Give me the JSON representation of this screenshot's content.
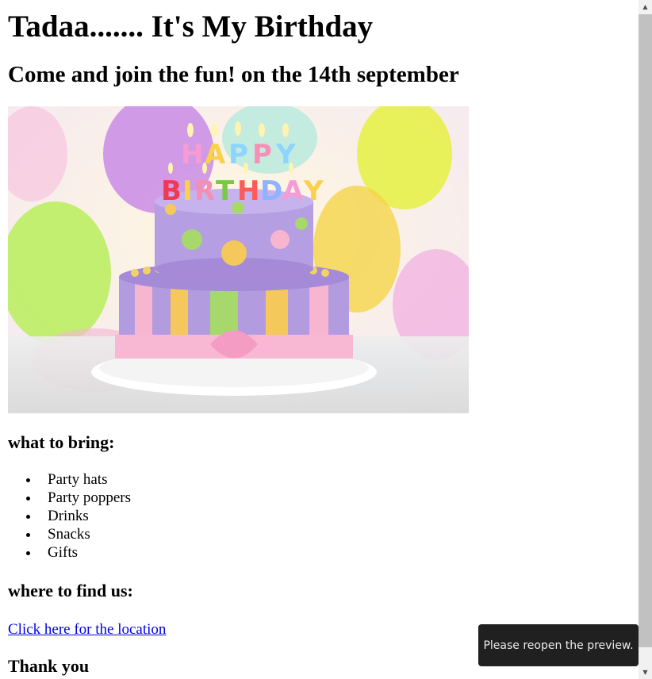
{
  "page": {
    "title": "Tadaa....... It's My Birthday",
    "subtitle": "Come and join the fun! on the 14th september",
    "hero_image_text": {
      "line1": "HAPPY",
      "line2": "BIRTHDAY"
    },
    "bring_heading": "what to bring:",
    "bring_items": [
      "Party hats",
      "Party poppers",
      "Drinks",
      "Snacks",
      "Gifts"
    ],
    "find_heading": "where to find us:",
    "location_link": "Click here for the location",
    "thanks_heading": "Thank you"
  },
  "toast": {
    "message": "Please reopen the preview."
  },
  "scrollbar": {
    "up_icon": "triangle-up-icon",
    "down_icon": "triangle-down-icon"
  }
}
